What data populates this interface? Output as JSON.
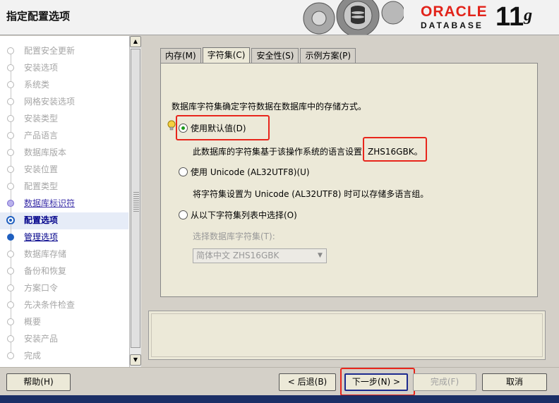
{
  "header": {
    "title": "指定配置选项",
    "logo_word": "ORACLE",
    "logo_sub": "DATABASE",
    "version_major": "11",
    "version_suffix": "g",
    "brand_color": "#e2231a"
  },
  "sidebar": {
    "steps": [
      {
        "label": "配置安全更新",
        "state": "pending"
      },
      {
        "label": "安装选项",
        "state": "pending"
      },
      {
        "label": "系统类",
        "state": "pending"
      },
      {
        "label": "网格安装选项",
        "state": "pending"
      },
      {
        "label": "安装类型",
        "state": "pending"
      },
      {
        "label": "产品语言",
        "state": "pending"
      },
      {
        "label": "数据库版本",
        "state": "pending"
      },
      {
        "label": "安装位置",
        "state": "pending"
      },
      {
        "label": "配置类型",
        "state": "pending"
      },
      {
        "label": "数据库标识符",
        "state": "done"
      },
      {
        "label": "配置选项",
        "state": "current"
      },
      {
        "label": "管理选项",
        "state": "next"
      },
      {
        "label": "数据库存储",
        "state": "pending"
      },
      {
        "label": "备份和恢复",
        "state": "pending"
      },
      {
        "label": "方案口令",
        "state": "pending"
      },
      {
        "label": "先决条件检查",
        "state": "pending"
      },
      {
        "label": "概要",
        "state": "pending"
      },
      {
        "label": "安装产品",
        "state": "pending"
      },
      {
        "label": "完成",
        "state": "pending"
      }
    ]
  },
  "tabs": [
    {
      "label": "内存(M)",
      "active": false
    },
    {
      "label": "字符集(C)",
      "active": true
    },
    {
      "label": "安全性(S)",
      "active": false
    },
    {
      "label": "示例方案(P)",
      "active": false
    }
  ],
  "charset": {
    "description": "数据库字符集确定字符数据在数据库中的存储方式。",
    "option_default": "使用默认值(D)",
    "default_hint_prefix": "此数据库的字符集基于该操作系统的语言设置:",
    "default_hint_value": "ZHS16GBK。",
    "option_unicode": "使用 Unicode (AL32UTF8)(U)",
    "unicode_hint": "将字符集设置为 Unicode (AL32UTF8) 时可以存储多语言组。",
    "option_list": "从以下字符集列表中选择(O)",
    "select_label": "选择数据库字符集(T):",
    "select_value": "简体中文 ZHS16GBK",
    "selected_option": "default"
  },
  "footer": {
    "help": "帮助(H)",
    "back": "< 后退(B)",
    "next": "下一步(N) >",
    "finish": "完成(F)",
    "cancel": "取消"
  },
  "colors": {
    "highlight": "#e8261c",
    "radio_dot": "#1a9a1a",
    "current_step": "#00008a"
  }
}
